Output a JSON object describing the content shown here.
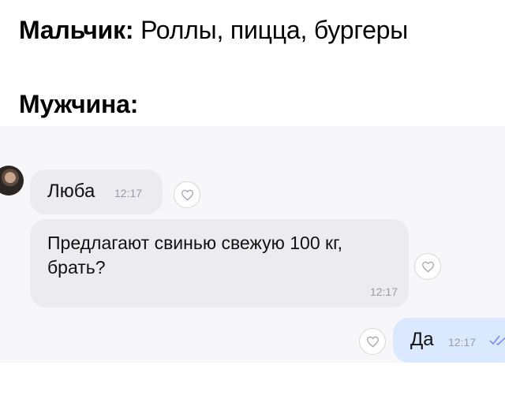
{
  "captions": {
    "boy_label": "Мальчик:",
    "boy_text": "Роллы,  пицца, бургеры",
    "man_label": "Мужчина:"
  },
  "chat": {
    "sender_name": "Люба",
    "sender_time": "12:17",
    "message_text": "Предлагают свинью свежую 100 кг, брать?",
    "message_time": "12:17",
    "reply_text": "Да",
    "reply_time": "12:17",
    "colors": {
      "incoming_bubble": "#ececf0",
      "outgoing_bubble": "#dbe9ff",
      "background": "#f7f7f9",
      "check": "#7a8cff"
    }
  }
}
